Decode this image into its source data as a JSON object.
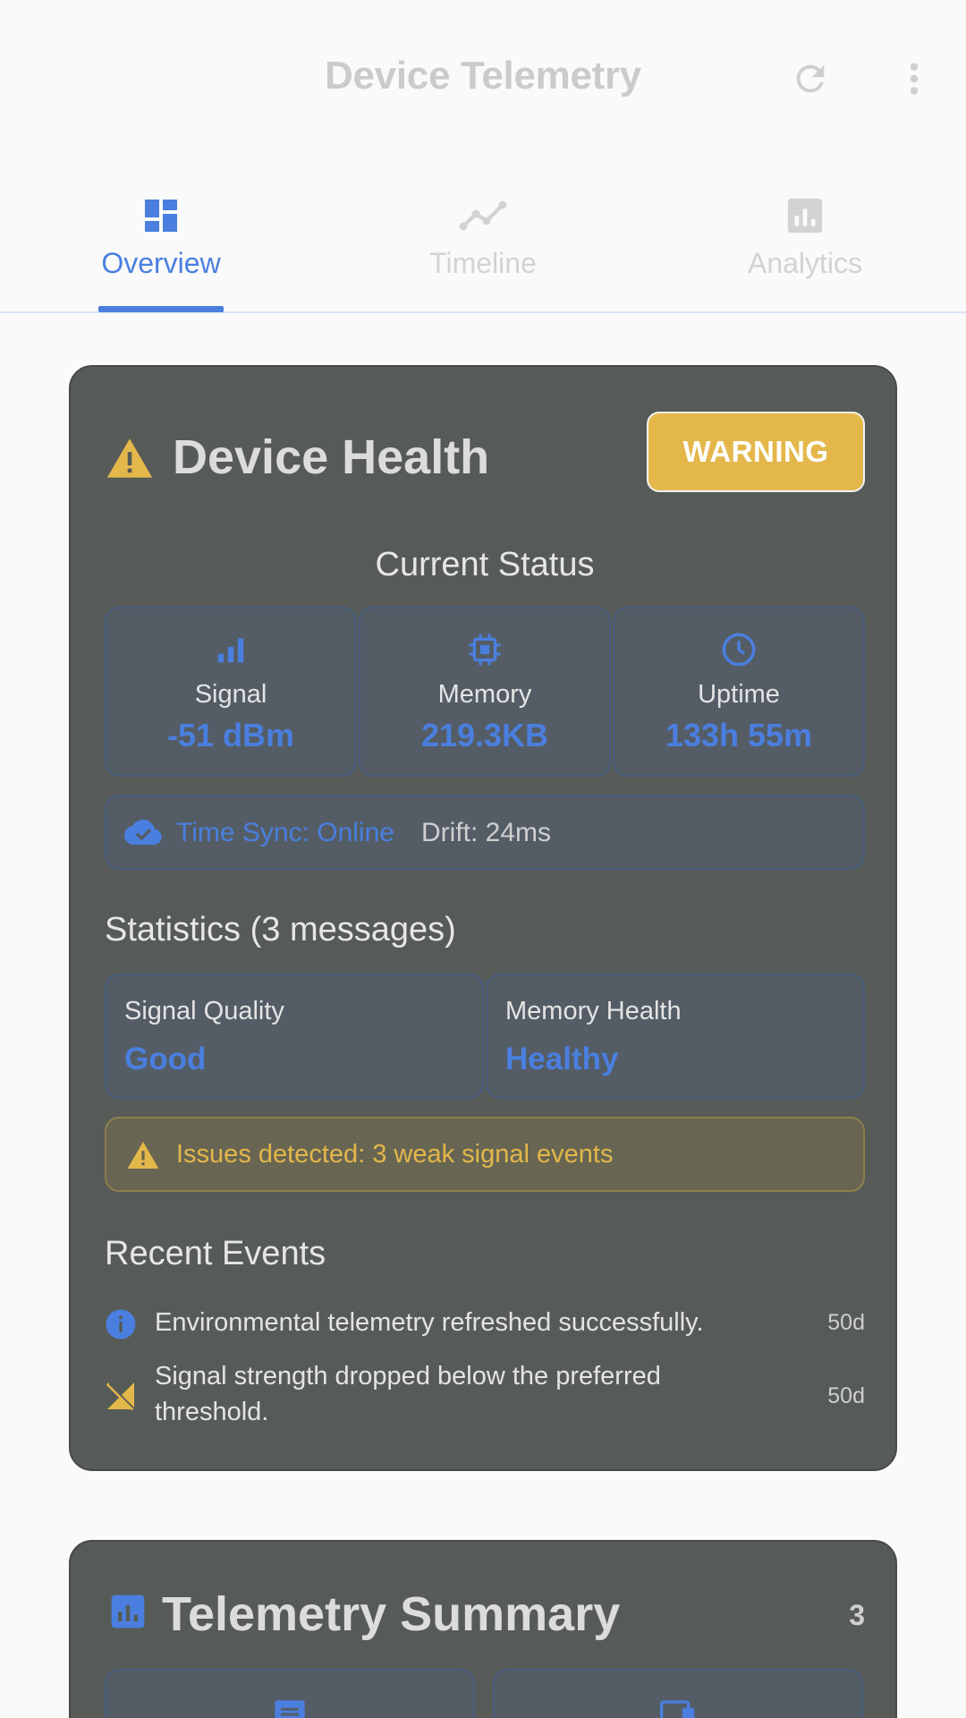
{
  "appbar": {
    "title": "Device Telemetry",
    "refresh_icon": "refresh-icon",
    "more_icon": "more-vert-icon"
  },
  "tabs": [
    {
      "label": "Overview",
      "icon": "dashboard-icon",
      "active": true
    },
    {
      "label": "Timeline",
      "icon": "timeline-icon",
      "active": false
    },
    {
      "label": "Analytics",
      "icon": "analytics-icon",
      "active": false
    }
  ],
  "health": {
    "title": "Device Health",
    "badge": "WARNING",
    "current_status": "Current Status",
    "metrics": [
      {
        "label": "Signal",
        "value": "-51 dBm",
        "icon": "signal-bars-icon"
      },
      {
        "label": "Memory",
        "value": "219.3KB",
        "icon": "memory-chip-icon"
      },
      {
        "label": "Uptime",
        "value": "133h 55m",
        "icon": "clock-icon"
      }
    ],
    "time_sync": {
      "status": "Time Sync: Online",
      "drift": "Drift: 24ms"
    },
    "statistics_heading": "Statistics (3 messages)",
    "stats": [
      {
        "label": "Signal Quality",
        "value": "Good"
      },
      {
        "label": "Memory Health",
        "value": "Healthy"
      }
    ],
    "issues": "Issues detected: 3 weak signal events",
    "recent_heading": "Recent Events",
    "events": [
      {
        "text": "Environmental telemetry refreshed successfully.",
        "time": "50d",
        "icon": "info-icon"
      },
      {
        "text": "Signal strength dropped below the preferred threshold.",
        "time": "50d",
        "icon": "signal-off-icon"
      }
    ]
  },
  "summary": {
    "title": "Telemetry Summary",
    "count": "3"
  },
  "colors": {
    "accent": "#4a7fdf",
    "warning": "#e3b74a",
    "card": "#575b57"
  }
}
